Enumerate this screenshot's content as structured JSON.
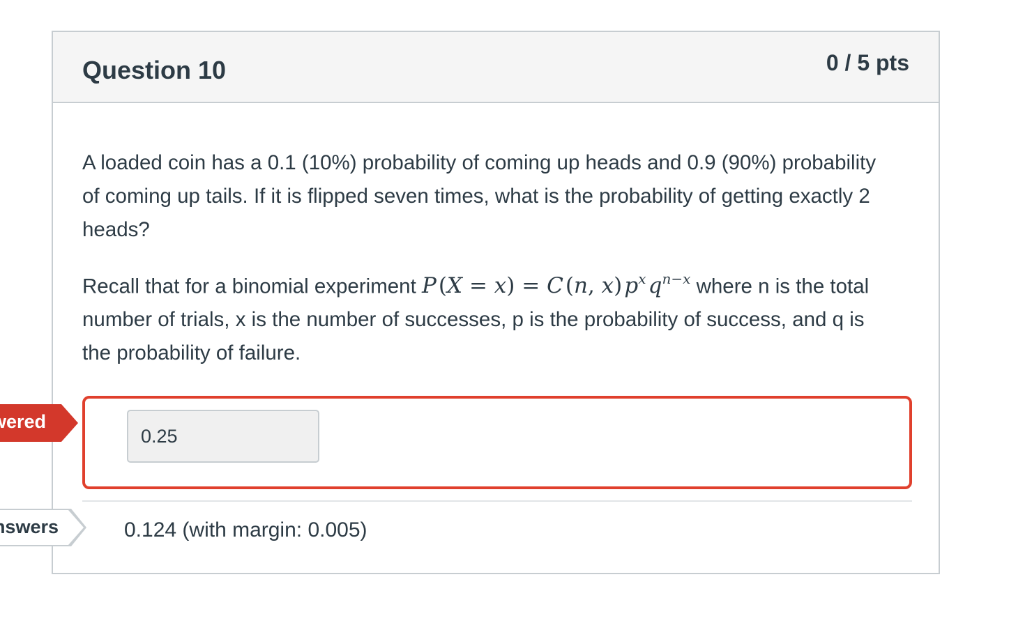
{
  "question": {
    "title": "Question 10",
    "points": "0 / 5 pts",
    "paragraph1": "A loaded coin has a 0.1 (10%) probability of coming up heads and 0.9 (90%) probability of coming up tails. If it is flipped seven times, what is the probability of getting exactly 2 heads?",
    "paragraph2_before": "Recall that for a binomial experiment ",
    "paragraph2_after": " where n is the total number of trials, x is the number of successes, p is the probability of success, and q is the probability of failure."
  },
  "answer": {
    "flag_label": "wered",
    "value": "0.25"
  },
  "correct": {
    "flag_label": "nswers",
    "text": "0.124 (with margin: 0.005)"
  },
  "colors": {
    "incorrect": "#e0402d",
    "flag_red": "#d3382b",
    "text": "#2d3b45",
    "border": "#c7cdd1"
  }
}
